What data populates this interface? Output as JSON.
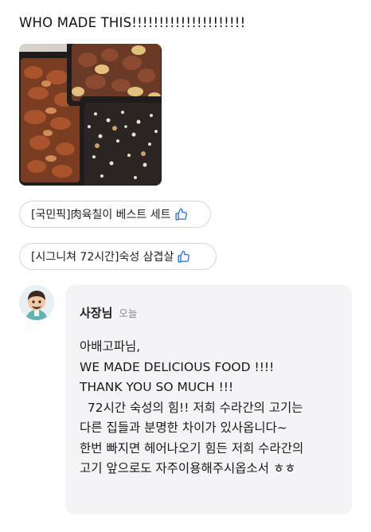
{
  "review": {
    "text": "WHO MADE THIS!!!!!!!!!!!!!!!!!!!!!"
  },
  "tags": [
    {
      "prefix": "[국민픽]",
      "name": "肉육칠이 베스트 세트",
      "icon": "thumbs-up-icon"
    },
    {
      "prefix": "[시그니쳐 72시간]",
      "name": "숙성 삼겹살",
      "icon": "thumbs-up-icon"
    }
  ],
  "reply": {
    "author": "사장님",
    "date": "오늘",
    "lines": [
      "아배고파님,",
      "WE MADE DELICIOUS FOOD !!!!",
      "THANK YOU SO MUCH !!!",
      "  72시간 숙성의 힘!! 저희 수라간의 고기는",
      "다른 집들과 분명한 차이가 있사옵니다~",
      "한번 빠지면 헤어나오기 힘든 저희 수라간의",
      "고기 앞으로도 자주이용해주시옵소서 ㅎㅎ"
    ]
  },
  "colors": {
    "accent": "#2f7cf6",
    "reply_background": "#f4f4f6",
    "tag_border": "#d6d6d6"
  }
}
